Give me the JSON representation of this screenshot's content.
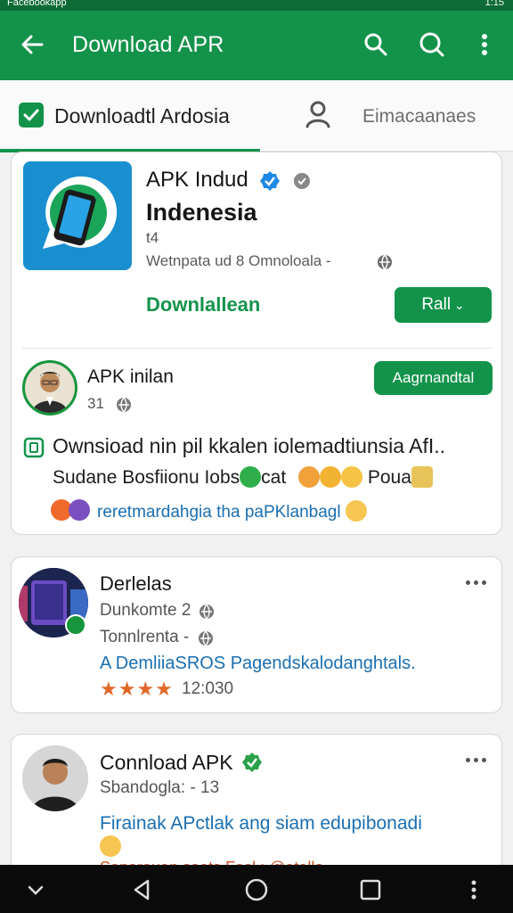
{
  "status_bar": {
    "left_text": "Facebookapp",
    "right_text": "1:15"
  },
  "app_bar": {
    "title": "Download APR",
    "icons": [
      "back-arrow-icon",
      "search-icon",
      "search-icon",
      "more-vert-icon"
    ],
    "color": "#13934a"
  },
  "tabs": [
    {
      "label": "Downloadtl Ardosia",
      "icon": "checkbox-icon",
      "selected": true
    },
    {
      "label": "Eimacaanaes",
      "icon": "person-icon",
      "selected": false
    }
  ],
  "app_card": {
    "name_line1": "APK Indud",
    "name_line2": "Indenesia",
    "tiny_text": "t4",
    "meta": "Wetnpata ud 8 Omnoloala -",
    "download_label": "Downlallean",
    "button_label": "Rall",
    "publisher": {
      "name": "APK inilan",
      "count": "31",
      "badge": "Aagrnandtal"
    },
    "desc_line1": "Ownsioad nin pil kkalen iolemadtiunsia AfI..",
    "desc_line2": "Sudane Bosfiionu Iobs",
    "desc_line2_b": "cat",
    "desc_line2_c": "Poua",
    "desc_line3": "reretmardahgia tha paPKlanbagl"
  },
  "post_card_1": {
    "name": "Derlelas",
    "line1": "Dunkomte 2",
    "line2": "Tonnlrenta -",
    "line3": "A DemliiaSROS Pagendskalodanghtals.",
    "stars": "★★★★",
    "rating": "12:030"
  },
  "post_card_2": {
    "name": "Connload APK",
    "line1": "Sbandogla: - 13",
    "line2": "Firainak APctlak ang siam edupibonadi",
    "cut_line": "Sanarauan saats Fasl : @atalla"
  },
  "nav_bar": {
    "icons": [
      "chevron-down-icon",
      "back-triangle-icon",
      "home-circle-icon",
      "recents-square-icon",
      "more-vert-icon"
    ]
  }
}
